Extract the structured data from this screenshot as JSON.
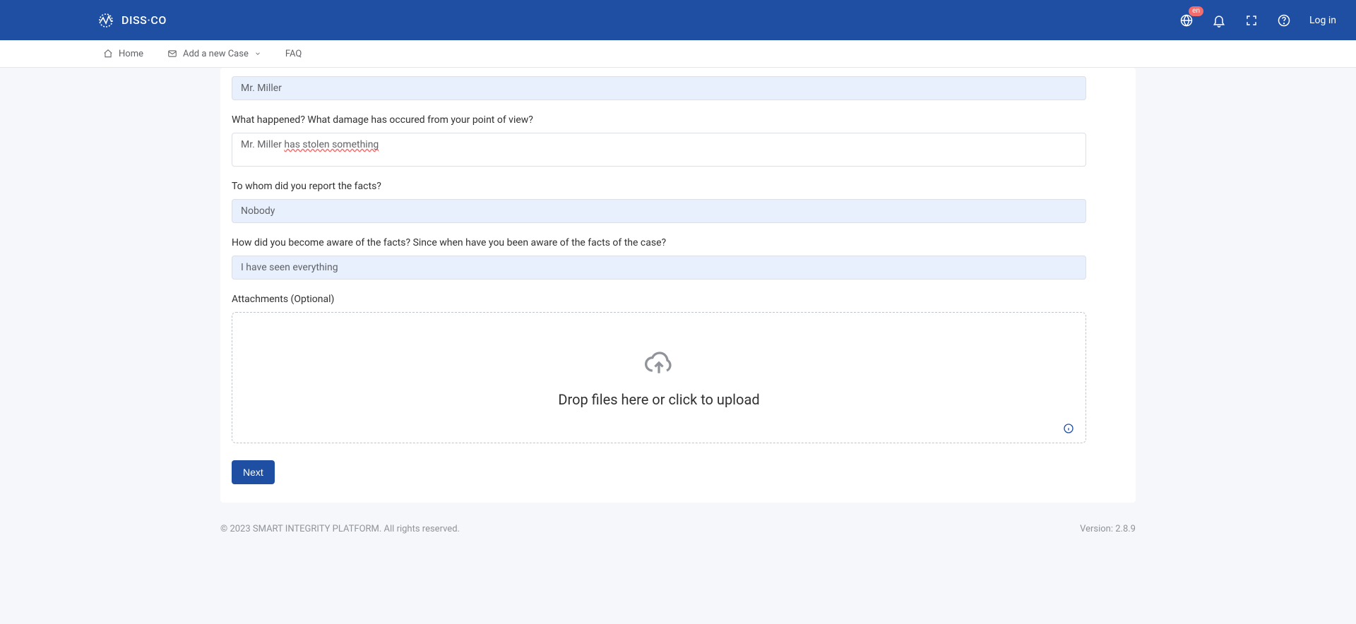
{
  "header": {
    "logo_text": "DISS·CO",
    "lang_badge": "en",
    "login_label": "Log in"
  },
  "subnav": {
    "home_label": "Home",
    "add_case_label": "Add a new Case",
    "faq_label": "FAQ"
  },
  "form": {
    "field1_value": "Mr. Miller",
    "q_what_happened": "What happened? What damage has occured from your point of view?",
    "what_happened_plain": "Mr. Miller ",
    "what_happened_err": "has stolen something",
    "q_report_to": "To whom did you report the facts?",
    "report_to_value": "Nobody",
    "q_aware": "How did you become aware of the facts? Since when have you been aware of the facts of the case?",
    "aware_value": "I have seen everything",
    "attachments_label": "Attachments (Optional)",
    "dropzone_text": "Drop files here or click to upload",
    "next_label": "Next"
  },
  "footer": {
    "copyright": "© 2023 SMART INTEGRITY PLATFORM. All rights reserved.",
    "version": "Version: 2.8.9"
  }
}
